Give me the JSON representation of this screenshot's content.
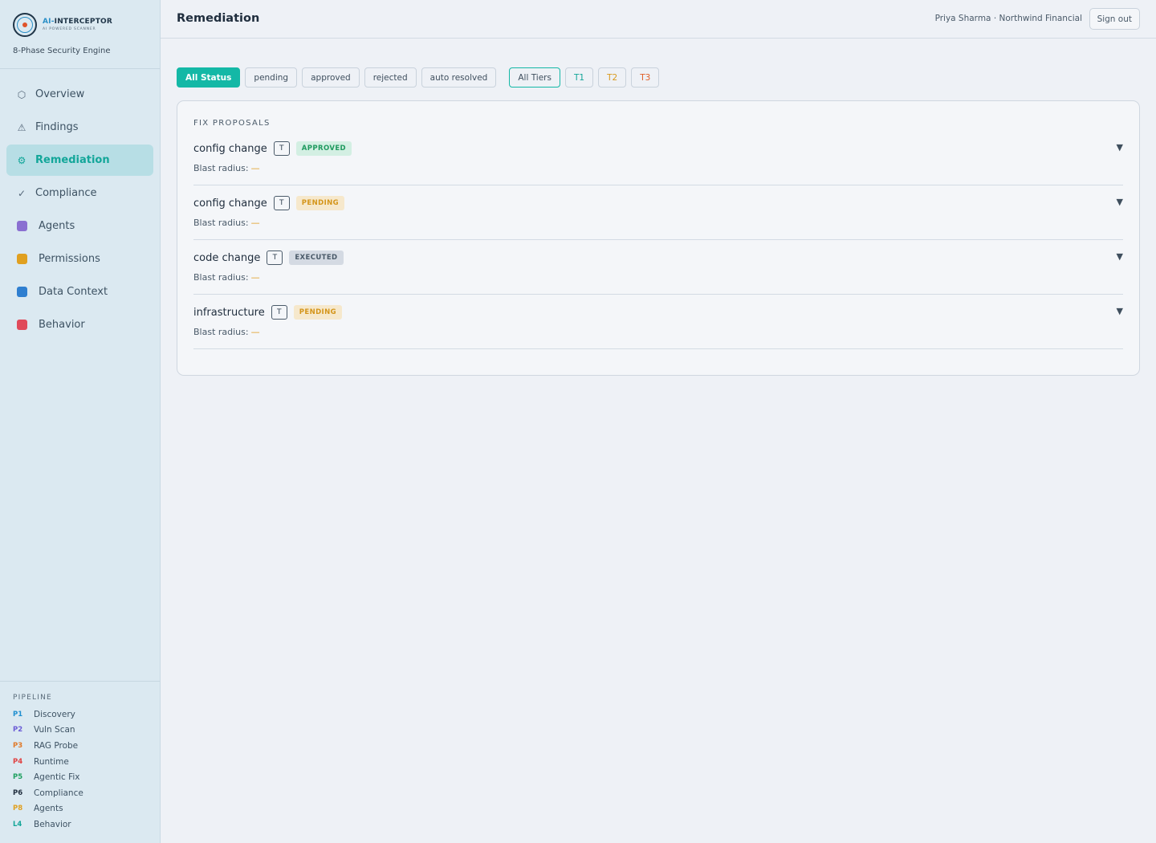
{
  "brand": {
    "name_ai": "AI-",
    "name_rest": "INTERCEPTOR",
    "tagline": "AI POWERED SCANNER",
    "subtitle": "8-Phase Security Engine"
  },
  "nav": [
    {
      "label": "Overview",
      "icon": "hexagon-icon",
      "glyph": "⬡",
      "active": false
    },
    {
      "label": "Findings",
      "icon": "warning-icon",
      "glyph": "⚠",
      "active": false
    },
    {
      "label": "Remediation",
      "icon": "gear-icon",
      "glyph": "⚙",
      "active": true
    },
    {
      "label": "Compliance",
      "icon": "check-icon",
      "glyph": "✓",
      "active": false
    },
    {
      "label": "Agents",
      "icon": "robot-icon",
      "color": "#8a6fd1",
      "active": false
    },
    {
      "label": "Permissions",
      "icon": "lock-icon",
      "color": "#e0a020",
      "active": false
    },
    {
      "label": "Data Context",
      "icon": "magnifier-icon",
      "color": "#2f7fd0",
      "active": false
    },
    {
      "label": "Behavior",
      "icon": "target-icon",
      "color": "#e04a5a",
      "active": false
    }
  ],
  "pipeline": {
    "heading": "PIPELINE",
    "items": [
      {
        "code": "P1",
        "label": "Discovery",
        "color": "#1f8fd0"
      },
      {
        "code": "P2",
        "label": "Vuln Scan",
        "color": "#6a5bd6"
      },
      {
        "code": "P3",
        "label": "RAG Probe",
        "color": "#e07a2a"
      },
      {
        "code": "P4",
        "label": "Runtime",
        "color": "#e04040"
      },
      {
        "code": "P5",
        "label": "Agentic Fix",
        "color": "#1fa060"
      },
      {
        "code": "P6",
        "label": "Compliance",
        "color": "#1f2d3d"
      },
      {
        "code": "P8",
        "label": "Agents",
        "color": "#e0a020"
      },
      {
        "code": "L4",
        "label": "Behavior",
        "color": "#14a699"
      }
    ]
  },
  "header": {
    "title": "Remediation",
    "user": "Priya Sharma · Northwind Financial",
    "signout": "Sign out"
  },
  "filters": {
    "status": [
      "All Status",
      "pending",
      "approved",
      "rejected",
      "auto resolved"
    ],
    "tiers": [
      {
        "label": "All Tiers",
        "color": "#3f4f5e"
      },
      {
        "label": "T1",
        "color": "#14a699"
      },
      {
        "label": "T2",
        "color": "#d99a1e"
      },
      {
        "label": "T3",
        "color": "#e0602a"
      }
    ]
  },
  "panel": {
    "heading": "FIX PROPOSALS",
    "blast_label": "Blast radius:",
    "blast_value": "—",
    "proposals": [
      {
        "title": "config change",
        "tier": "T",
        "status": "APPROVED",
        "badge_bg": "#d3efe3",
        "badge_fg": "#1f9a5f"
      },
      {
        "title": "config change",
        "tier": "T",
        "status": "PENDING",
        "badge_bg": "#f6e8cc",
        "badge_fg": "#d4951a"
      },
      {
        "title": "code change",
        "tier": "T",
        "status": "EXECUTED",
        "badge_bg": "#d4dae3",
        "badge_fg": "#4a5a69"
      },
      {
        "title": "infrastructure",
        "tier": "T",
        "status": "PENDING",
        "badge_bg": "#f6e8cc",
        "badge_fg": "#d4951a"
      }
    ]
  }
}
